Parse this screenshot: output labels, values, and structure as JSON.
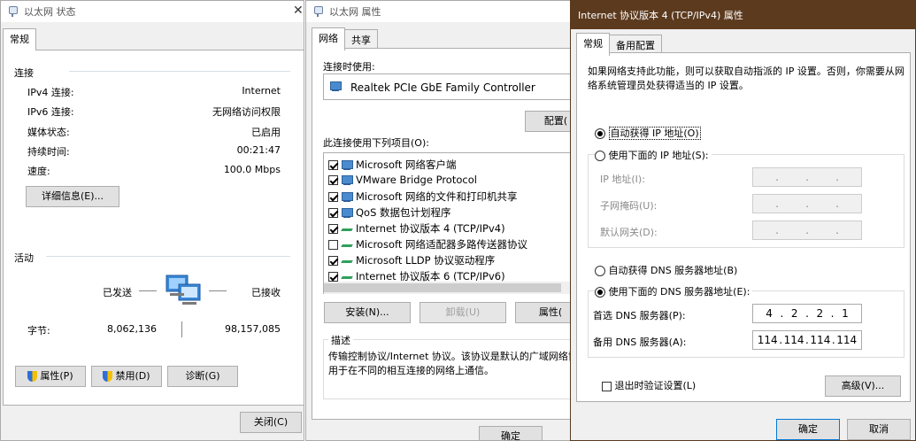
{
  "win1": {
    "title": "以太网 状态",
    "tab_general": "常规",
    "section_connection": "连接",
    "rows": [
      {
        "label": "IPv4 连接:",
        "value": "Internet"
      },
      {
        "label": "IPv6 连接:",
        "value": "无网络访问权限"
      },
      {
        "label": "媒体状态:",
        "value": "已启用"
      },
      {
        "label": "持续时间:",
        "value": "00:21:47"
      },
      {
        "label": "速度:",
        "value": "100.0 Mbps"
      }
    ],
    "details_button": "详细信息(E)...",
    "section_activity": "活动",
    "sent_label": "已发送",
    "received_label": "已接收",
    "bytes_label": "字节:",
    "bytes_sent": "8,062,136",
    "bytes_received": "98,157,085",
    "properties_button": "属性(P)",
    "disable_button": "禁用(D)",
    "diagnose_button": "诊断(G)",
    "close_button": "关闭(C)"
  },
  "win2": {
    "title": "以太网 属性",
    "tab_network": "网络",
    "tab_sharing": "共享",
    "connect_using_label": "连接时使用:",
    "adapter_name": "Realtek PCIe GbE Family Controller",
    "configure_button": "配置(",
    "items_label": "此连接使用下列项目(O):",
    "items": [
      {
        "label": "Microsoft 网络客户端",
        "checked": true,
        "icon": "network-client-icon"
      },
      {
        "label": "VMware Bridge Protocol",
        "checked": true,
        "icon": "network-client-icon"
      },
      {
        "label": "Microsoft 网络的文件和打印机共享",
        "checked": true,
        "icon": "network-client-icon"
      },
      {
        "label": "QoS 数据包计划程序",
        "checked": true,
        "icon": "network-client-icon"
      },
      {
        "label": "Internet 协议版本 4 (TCP/IPv4)",
        "checked": true,
        "icon": "protocol-icon"
      },
      {
        "label": "Microsoft 网络适配器多路传送器协议",
        "checked": false,
        "icon": "protocol-icon"
      },
      {
        "label": "Microsoft LLDP 协议驱动程序",
        "checked": true,
        "icon": "protocol-icon"
      },
      {
        "label": "Internet 协议版本 6 (TCP/IPv6)",
        "checked": true,
        "icon": "protocol-icon"
      }
    ],
    "install_button": "安装(N)...",
    "uninstall_button": "卸载(U)",
    "properties_button": "属性(",
    "description_label": "描述",
    "description_text_1": "传输控制协议/Internet 协议。该协议是默认的广域网络协",
    "description_text_2": "用于在不同的相互连接的网络上通信。",
    "ok_button": "确定"
  },
  "win3": {
    "title": "Internet 协议版本 4 (TCP/IPv4) 属性",
    "tab_general": "常规",
    "tab_alternate": "备用配置",
    "intro_1": "如果网络支持此功能，则可以获取自动指派的 IP 设置。否则，你需要从网",
    "intro_2": "络系统管理员处获得适当的 IP 设置。",
    "auto_ip_label": "自动获得 IP 地址(O)",
    "manual_ip_label": "使用下面的 IP 地址(S):",
    "ip_address_label": "IP 地址(I):",
    "subnet_label": "子网掩码(U):",
    "gateway_label": "默认网关(D):",
    "empty_ip": [
      ".",
      ".",
      "."
    ],
    "auto_dns_label": "自动获得 DNS 服务器地址(B)",
    "manual_dns_label": "使用下面的 DNS 服务器地址(E):",
    "preferred_dns_label": "首选 DNS 服务器(P):",
    "alternate_dns_label": "备用 DNS 服务器(A):",
    "preferred_dns": [
      "4",
      ".",
      "2",
      ".",
      "2",
      ".",
      "1"
    ],
    "alternate_dns": [
      "114",
      ".",
      "114",
      ".",
      "114",
      ".",
      "114"
    ],
    "validate_label": "退出时验证设置(L)",
    "advanced_button": "高级(V)...",
    "ok_button": "确定",
    "cancel_button": "取消"
  }
}
